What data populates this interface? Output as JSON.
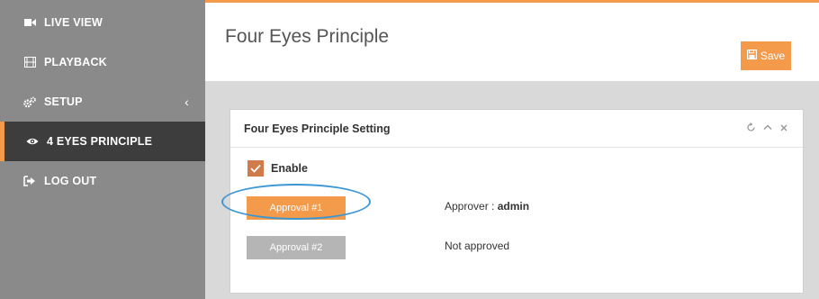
{
  "sidebar": {
    "items": [
      {
        "label": "LIVE VIEW",
        "icon": "video-camera-icon"
      },
      {
        "label": "PLAYBACK",
        "icon": "film-icon"
      },
      {
        "label": "SETUP",
        "icon": "gears-icon",
        "chevron": "‹"
      },
      {
        "label": "4 EYES PRINCIPLE",
        "icon": "eye-icon",
        "active": true
      },
      {
        "label": "LOG OUT",
        "icon": "logout-icon"
      }
    ]
  },
  "header": {
    "title": "Four Eyes Principle",
    "save_label": "Save"
  },
  "panel": {
    "title": "Four Eyes Principle Setting",
    "enable_label": "Enable",
    "enable_checked": true,
    "approvals": [
      {
        "button_label": "Approval #1",
        "status_prefix": "Approver : ",
        "status_value": "admin"
      },
      {
        "button_label": "Approval #2",
        "status_text": "Not approved"
      }
    ]
  },
  "colors": {
    "accent": "#f39a4b",
    "sidebar_bg": "#8a8a8a",
    "active_bg": "#3d3d3d",
    "checkbox": "#d27b4a",
    "highlight_ring": "#3b97d3",
    "disabled_button": "#b5b5b5"
  }
}
